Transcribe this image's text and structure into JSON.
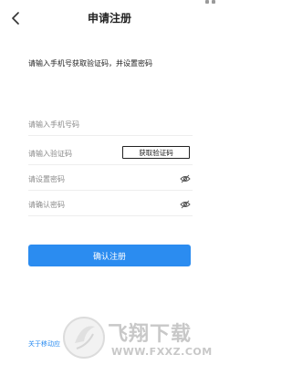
{
  "header": {
    "title": "申请注册",
    "back_icon": "chevron-left-icon"
  },
  "instruction": "请输入手机号获取验证码，并设置密码",
  "fields": {
    "phone_placeholder": "请输入手机号码",
    "code_placeholder": "请输入验证码",
    "get_code_label": "获取验证码",
    "password_placeholder": "请设置密码",
    "confirm_placeholder": "请确认密码",
    "password_icon": "eye-off-icon"
  },
  "submit_label": "确认注册",
  "footer_link": "关于移动应",
  "watermark": {
    "text_cn": "飞翔下载",
    "text_en": "WWW.FXXZ.COM"
  },
  "colors": {
    "accent": "#2b8cf0",
    "text_primary": "#222222",
    "placeholder": "#8a8a8a",
    "divider": "#eeeeee",
    "watermark": "#c8c8c8"
  }
}
